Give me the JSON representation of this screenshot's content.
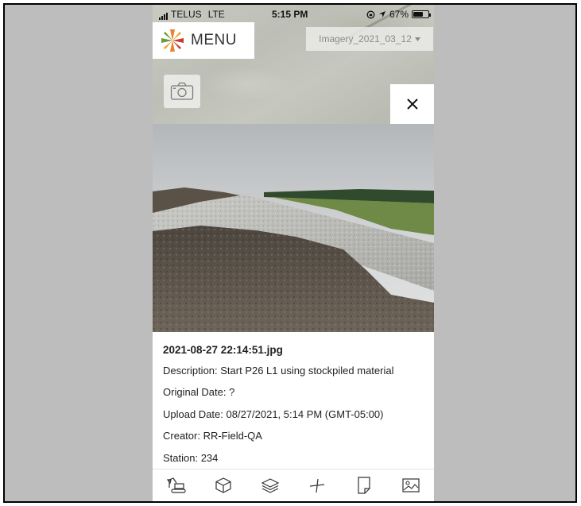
{
  "status_bar": {
    "carrier": "TELUS",
    "network": "LTE",
    "time": "5:15 PM",
    "battery": "67%",
    "battery_level": 0.67
  },
  "menu": {
    "label": "MENU"
  },
  "imagery_selector": {
    "selected": "Imagery_2021_03_12"
  },
  "photo_detail": {
    "filename": "2021-08-27 22:14:51.jpg",
    "description": "Description: Start P26 L1 using stockpiled material",
    "original_date": "Original Date: ?",
    "upload_date": "Upload Date: 08/27/2021, 5:14 PM (GMT-05:00)",
    "creator": "Creator: RR-Field-QA",
    "station": "Station: 234"
  },
  "toolbar": {
    "items": [
      {
        "icon": "excavator-icon"
      },
      {
        "icon": "cube-icon"
      },
      {
        "icon": "layers-icon"
      },
      {
        "icon": "measure-icon"
      },
      {
        "icon": "document-icon"
      },
      {
        "icon": "image-icon"
      }
    ]
  },
  "colors": {
    "accent_orange": "#e9822a",
    "accent_green": "#6a9a35",
    "accent_red": "#c73a2c",
    "text": "#222222"
  }
}
